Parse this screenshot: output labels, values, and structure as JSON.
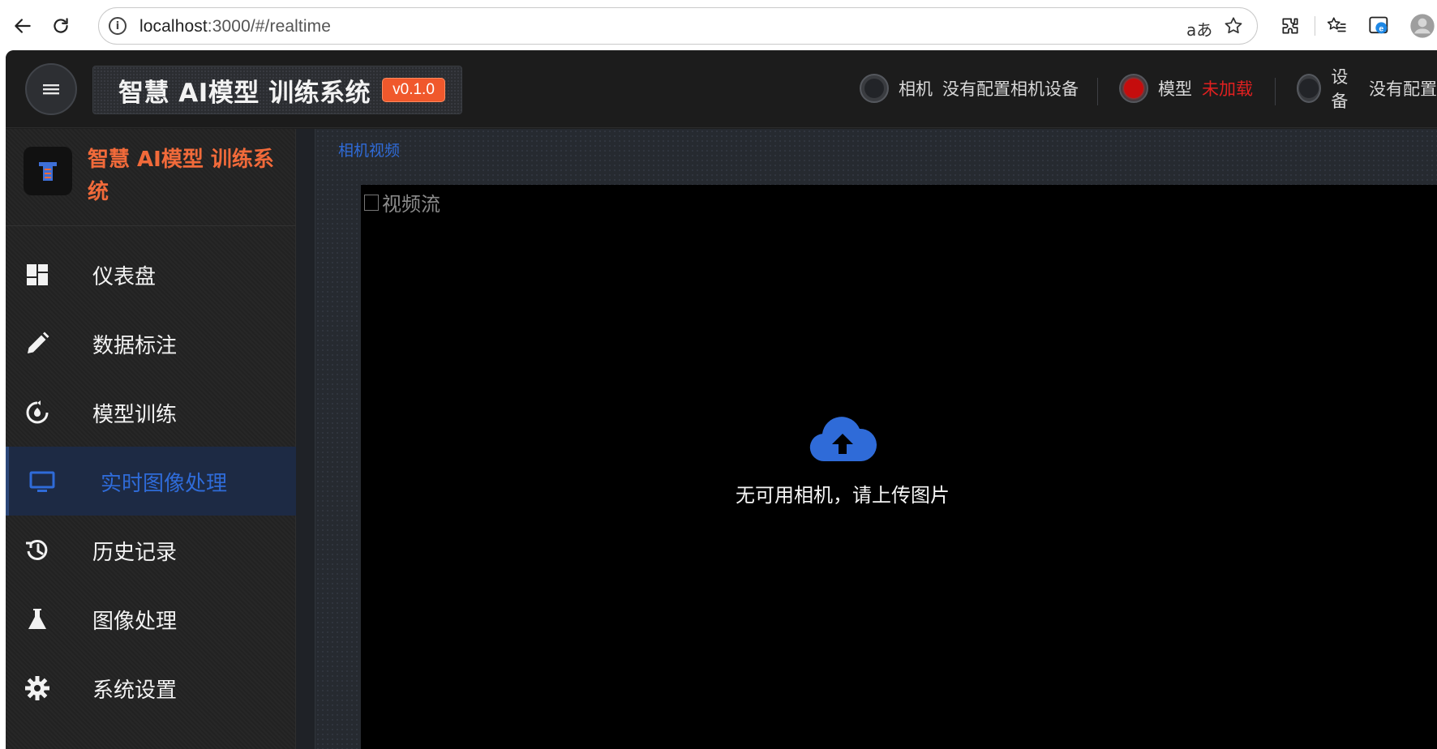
{
  "browser": {
    "url_host": "localhost",
    "url_path": ":3000/#/realtime",
    "translate_glyph": "aあ"
  },
  "header": {
    "title": "智慧 AI模型 训练系统",
    "version": "v0.1.0",
    "statuses": [
      {
        "label": "相机",
        "value": "没有配置相机设备",
        "state": "off"
      },
      {
        "label": "模型",
        "value": "未加载",
        "state": "error"
      },
      {
        "label": "设备",
        "value": "没有配置",
        "state": "off"
      }
    ]
  },
  "sidebar": {
    "brand": "智慧 AI模型 训练系统",
    "items": [
      {
        "label": "仪表盘",
        "icon": "dashboard-icon"
      },
      {
        "label": "数据标注",
        "icon": "pencil-icon"
      },
      {
        "label": "模型训练",
        "icon": "training-icon"
      },
      {
        "label": "实时图像处理",
        "icon": "monitor-icon",
        "active": true
      },
      {
        "label": "历史记录",
        "icon": "history-icon"
      },
      {
        "label": "图像处理",
        "icon": "flask-icon"
      },
      {
        "label": "系统设置",
        "icon": "gear-icon"
      }
    ]
  },
  "main": {
    "section_title": "相机视频",
    "video_alt": "视频流",
    "empty_message": "无可用相机，请上传图片"
  },
  "colors": {
    "accent_blue": "#2f6bd8",
    "brand_orange": "#f16a3a",
    "error_red": "#e02020"
  }
}
